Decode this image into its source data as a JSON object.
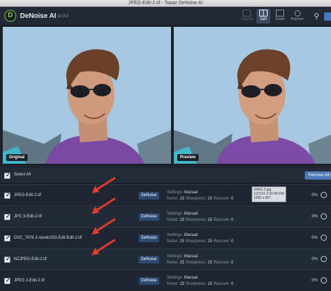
{
  "window": {
    "title": "JPEG-Edit-2.tif - Topaz DeNoise AI"
  },
  "app": {
    "logo_letter": "D",
    "name": "DeNoise AI",
    "version": "v2.0.0"
  },
  "view_modes": [
    {
      "label": "Original",
      "state": "dim"
    },
    {
      "label": "Split",
      "state": "active"
    },
    {
      "label": "Single",
      "state": "normal"
    },
    {
      "label": "Brighten",
      "state": "normal"
    }
  ],
  "preview": {
    "left_label": "Original",
    "right_label": "Preview"
  },
  "list": {
    "select_all": "Select All",
    "remove_button": "Remove All Images",
    "denoise_button": "DeNoise",
    "settings_prefix": "Settings:",
    "noise_label": "Noise:",
    "sharpness_label": "Sharpness:",
    "recover_label": "Recover:",
    "rows": [
      {
        "name": "JPEG-Edit-2.tif",
        "mode": "Manual",
        "noise": "15",
        "sharpness": "15",
        "recover": "0",
        "progress": "0%"
      },
      {
        "name": "JPG 3-Edit-2.tif",
        "mode": "Manual",
        "noise": "15",
        "sharpness": "15",
        "recover": "0",
        "progress": "0%"
      },
      {
        "name": "DSC_7876 2-studio333-Edit-Edit-2.tif",
        "mode": "Manual",
        "noise": "15",
        "sharpness": "15",
        "recover": "0",
        "progress": "0%"
      },
      {
        "name": "NZJPEG-Edit-2.tif",
        "mode": "Manual",
        "noise": "15",
        "sharpness": "15",
        "recover": "0",
        "progress": "0%"
      },
      {
        "name": "JPEG 2-Edit-2.tif",
        "mode": "Manual",
        "noise": "15",
        "sharpness": "15",
        "recover": "0",
        "progress": "0%"
      }
    ]
  },
  "tooltip": {
    "line1": "JPEG 2.jpg",
    "line2": "1/21/16 2:30:46 PM",
    "line3": "1000 x 667"
  },
  "colors": {
    "accent": "#4b79b8",
    "arrow": "#e23b2e",
    "background": "#1f2531"
  }
}
